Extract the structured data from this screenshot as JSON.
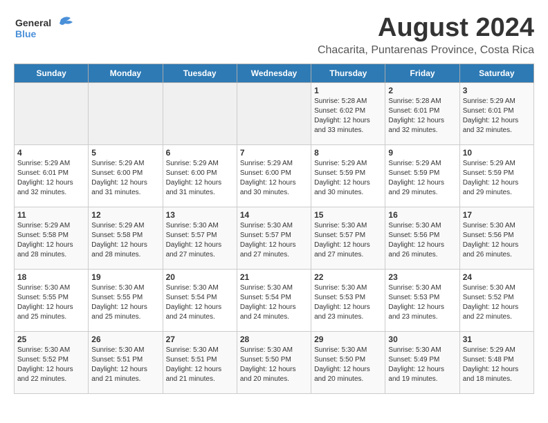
{
  "logo": {
    "line1": "General",
    "line2": "Blue"
  },
  "title": "August 2024",
  "subtitle": "Chacarita, Puntarenas Province, Costa Rica",
  "days_of_week": [
    "Sunday",
    "Monday",
    "Tuesday",
    "Wednesday",
    "Thursday",
    "Friday",
    "Saturday"
  ],
  "weeks": [
    [
      {
        "day": "",
        "info": ""
      },
      {
        "day": "",
        "info": ""
      },
      {
        "day": "",
        "info": ""
      },
      {
        "day": "",
        "info": ""
      },
      {
        "day": "1",
        "info": "Sunrise: 5:28 AM\nSunset: 6:02 PM\nDaylight: 12 hours\nand 33 minutes."
      },
      {
        "day": "2",
        "info": "Sunrise: 5:28 AM\nSunset: 6:01 PM\nDaylight: 12 hours\nand 32 minutes."
      },
      {
        "day": "3",
        "info": "Sunrise: 5:29 AM\nSunset: 6:01 PM\nDaylight: 12 hours\nand 32 minutes."
      }
    ],
    [
      {
        "day": "4",
        "info": "Sunrise: 5:29 AM\nSunset: 6:01 PM\nDaylight: 12 hours\nand 32 minutes."
      },
      {
        "day": "5",
        "info": "Sunrise: 5:29 AM\nSunset: 6:00 PM\nDaylight: 12 hours\nand 31 minutes."
      },
      {
        "day": "6",
        "info": "Sunrise: 5:29 AM\nSunset: 6:00 PM\nDaylight: 12 hours\nand 31 minutes."
      },
      {
        "day": "7",
        "info": "Sunrise: 5:29 AM\nSunset: 6:00 PM\nDaylight: 12 hours\nand 30 minutes."
      },
      {
        "day": "8",
        "info": "Sunrise: 5:29 AM\nSunset: 5:59 PM\nDaylight: 12 hours\nand 30 minutes."
      },
      {
        "day": "9",
        "info": "Sunrise: 5:29 AM\nSunset: 5:59 PM\nDaylight: 12 hours\nand 29 minutes."
      },
      {
        "day": "10",
        "info": "Sunrise: 5:29 AM\nSunset: 5:59 PM\nDaylight: 12 hours\nand 29 minutes."
      }
    ],
    [
      {
        "day": "11",
        "info": "Sunrise: 5:29 AM\nSunset: 5:58 PM\nDaylight: 12 hours\nand 28 minutes."
      },
      {
        "day": "12",
        "info": "Sunrise: 5:29 AM\nSunset: 5:58 PM\nDaylight: 12 hours\nand 28 minutes."
      },
      {
        "day": "13",
        "info": "Sunrise: 5:30 AM\nSunset: 5:57 PM\nDaylight: 12 hours\nand 27 minutes."
      },
      {
        "day": "14",
        "info": "Sunrise: 5:30 AM\nSunset: 5:57 PM\nDaylight: 12 hours\nand 27 minutes."
      },
      {
        "day": "15",
        "info": "Sunrise: 5:30 AM\nSunset: 5:57 PM\nDaylight: 12 hours\nand 27 minutes."
      },
      {
        "day": "16",
        "info": "Sunrise: 5:30 AM\nSunset: 5:56 PM\nDaylight: 12 hours\nand 26 minutes."
      },
      {
        "day": "17",
        "info": "Sunrise: 5:30 AM\nSunset: 5:56 PM\nDaylight: 12 hours\nand 26 minutes."
      }
    ],
    [
      {
        "day": "18",
        "info": "Sunrise: 5:30 AM\nSunset: 5:55 PM\nDaylight: 12 hours\nand 25 minutes."
      },
      {
        "day": "19",
        "info": "Sunrise: 5:30 AM\nSunset: 5:55 PM\nDaylight: 12 hours\nand 25 minutes."
      },
      {
        "day": "20",
        "info": "Sunrise: 5:30 AM\nSunset: 5:54 PM\nDaylight: 12 hours\nand 24 minutes."
      },
      {
        "day": "21",
        "info": "Sunrise: 5:30 AM\nSunset: 5:54 PM\nDaylight: 12 hours\nand 24 minutes."
      },
      {
        "day": "22",
        "info": "Sunrise: 5:30 AM\nSunset: 5:53 PM\nDaylight: 12 hours\nand 23 minutes."
      },
      {
        "day": "23",
        "info": "Sunrise: 5:30 AM\nSunset: 5:53 PM\nDaylight: 12 hours\nand 23 minutes."
      },
      {
        "day": "24",
        "info": "Sunrise: 5:30 AM\nSunset: 5:52 PM\nDaylight: 12 hours\nand 22 minutes."
      }
    ],
    [
      {
        "day": "25",
        "info": "Sunrise: 5:30 AM\nSunset: 5:52 PM\nDaylight: 12 hours\nand 22 minutes."
      },
      {
        "day": "26",
        "info": "Sunrise: 5:30 AM\nSunset: 5:51 PM\nDaylight: 12 hours\nand 21 minutes."
      },
      {
        "day": "27",
        "info": "Sunrise: 5:30 AM\nSunset: 5:51 PM\nDaylight: 12 hours\nand 21 minutes."
      },
      {
        "day": "28",
        "info": "Sunrise: 5:30 AM\nSunset: 5:50 PM\nDaylight: 12 hours\nand 20 minutes."
      },
      {
        "day": "29",
        "info": "Sunrise: 5:30 AM\nSunset: 5:50 PM\nDaylight: 12 hours\nand 20 minutes."
      },
      {
        "day": "30",
        "info": "Sunrise: 5:30 AM\nSunset: 5:49 PM\nDaylight: 12 hours\nand 19 minutes."
      },
      {
        "day": "31",
        "info": "Sunrise: 5:29 AM\nSunset: 5:48 PM\nDaylight: 12 hours\nand 18 minutes."
      }
    ]
  ]
}
